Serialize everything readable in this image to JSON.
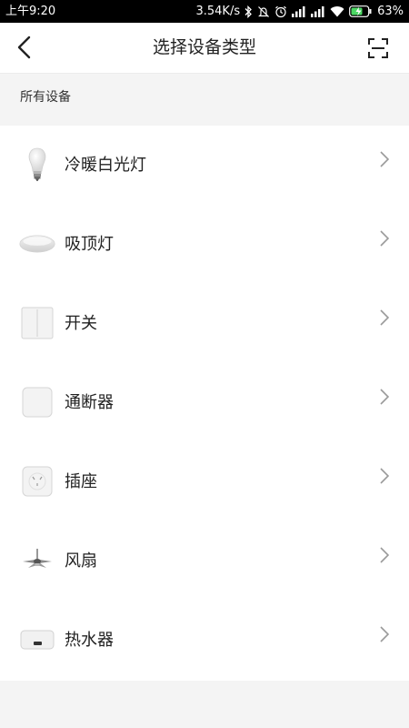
{
  "status_bar": {
    "time": "上午9:20",
    "network_speed": "3.54K/s",
    "battery": "63%"
  },
  "header": {
    "title": "选择设备类型"
  },
  "section": {
    "title": "所有设备"
  },
  "devices": [
    {
      "label": "冷暖白光灯",
      "icon": "light-bulb-icon"
    },
    {
      "label": "吸顶灯",
      "icon": "ceiling-light-icon"
    },
    {
      "label": "开关",
      "icon": "wall-switch-icon"
    },
    {
      "label": "通断器",
      "icon": "relay-switch-icon"
    },
    {
      "label": "插座",
      "icon": "power-socket-icon"
    },
    {
      "label": "风扇",
      "icon": "ceiling-fan-icon"
    },
    {
      "label": "热水器",
      "icon": "water-heater-icon"
    }
  ],
  "colors": {
    "status_bar_bg": "#000000",
    "page_bg": "#f4f4f4",
    "list_bg": "#ffffff",
    "text": "#222222",
    "chevron": "#9a9a9a"
  }
}
